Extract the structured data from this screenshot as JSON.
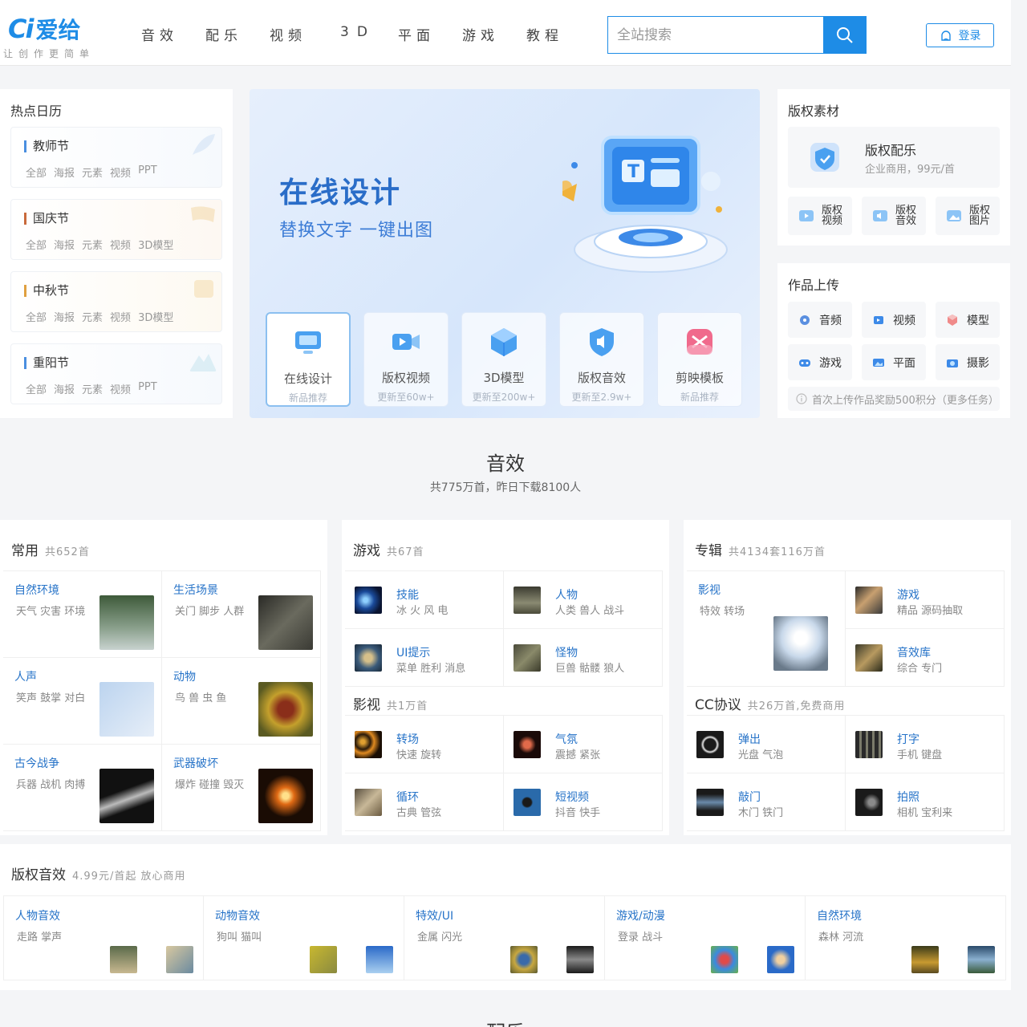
{
  "header": {
    "logo_ci": "Ci",
    "logo_name": "爱给",
    "slogan": "让创作更简单",
    "nav": [
      "音效",
      "配乐",
      "视频",
      "3D",
      "平面",
      "游戏",
      "教程"
    ],
    "search_placeholder": "全站搜索",
    "login": "登录"
  },
  "hot": {
    "title": "热点日历",
    "items": [
      {
        "name": "教师节",
        "tags": [
          "全部",
          "海报",
          "元素",
          "视频",
          "PPT"
        ],
        "color": "#4a8fe0"
      },
      {
        "name": "国庆节",
        "tags": [
          "全部",
          "海报",
          "元素",
          "视频",
          "3D模型"
        ],
        "color": "#c96a3c"
      },
      {
        "name": "中秋节",
        "tags": [
          "全部",
          "海报",
          "元素",
          "视频",
          "3D模型"
        ],
        "color": "#e0a040"
      },
      {
        "name": "重阳节",
        "tags": [
          "全部",
          "海报",
          "元素",
          "视频",
          "PPT"
        ],
        "color": "#4a8fe0"
      }
    ]
  },
  "banner": {
    "title": "在线设计",
    "subtitle": "替换文字  一键出图",
    "features": [
      {
        "label": "在线设计",
        "sub": "新品推荐"
      },
      {
        "label": "版权视频",
        "sub": "更新至60w+"
      },
      {
        "label": "3D模型",
        "sub": "更新至200w+"
      },
      {
        "label": "版权音效",
        "sub": "更新至2.9w+"
      },
      {
        "label": "剪映模板",
        "sub": "新品推荐"
      }
    ]
  },
  "copyright": {
    "title": "版权素材",
    "main_name": "版权配乐",
    "main_desc": "企业商用，99元/首",
    "subs": [
      {
        "label": "版权视频"
      },
      {
        "label": "版权音效"
      },
      {
        "label": "版权图片"
      }
    ]
  },
  "upload": {
    "title": "作品上传",
    "items": [
      "音频",
      "视频",
      "模型",
      "游戏",
      "平面",
      "摄影"
    ],
    "tip": "首次上传作品奖励500积分（更多任务）"
  },
  "section": {
    "title": "音效",
    "subtitle": "共775万首，昨日下载8100人"
  },
  "common": {
    "title": "常用",
    "count": "共652首",
    "cells": [
      {
        "name": "自然环境",
        "tags": "天气 灾害 环境"
      },
      {
        "name": "生活场景",
        "tags": "关门 脚步 人群"
      },
      {
        "name": "人声",
        "tags": "笑声 鼓掌 对白"
      },
      {
        "name": "动物",
        "tags": "鸟 兽 虫 鱼"
      },
      {
        "name": "古今战争",
        "tags": "兵器 战机 肉搏"
      },
      {
        "name": "武器破坏",
        "tags": "爆炸 碰撞 毁灭"
      }
    ]
  },
  "game": {
    "title": "游戏",
    "count": "共67首",
    "cells": [
      {
        "name": "技能",
        "tags": "冰 火 风 电"
      },
      {
        "name": "人物",
        "tags": "人类 兽人 战斗"
      },
      {
        "name": "UI提示",
        "tags": "菜单 胜利 消息"
      },
      {
        "name": "怪物",
        "tags": "巨兽 骷髅 狼人"
      }
    ]
  },
  "film": {
    "title": "影视",
    "count": "共1万首",
    "cells": [
      {
        "name": "转场",
        "tags": "快速 旋转"
      },
      {
        "name": "气氛",
        "tags": "震撼 紧张"
      },
      {
        "name": "循环",
        "tags": "古典 管弦"
      },
      {
        "name": "短视频",
        "tags": "抖音 快手"
      }
    ]
  },
  "album": {
    "title": "专辑",
    "count": "共4134套116万首",
    "big": {
      "name": "影视",
      "tags": "特效 转场"
    },
    "cells": [
      {
        "name": "游戏",
        "tags": "精品 源码抽取"
      },
      {
        "name": "音效库",
        "tags": "综合 专门"
      }
    ]
  },
  "cc": {
    "title": "CC协议",
    "count": "共26万首,免费商用",
    "cells": [
      {
        "name": "弹出",
        "tags": "光盘 气泡"
      },
      {
        "name": "打字",
        "tags": "手机 键盘"
      },
      {
        "name": "敲门",
        "tags": "木门 铁门"
      },
      {
        "name": "拍照",
        "tags": "相机 宝利来"
      }
    ]
  },
  "paid": {
    "title": "版权音效",
    "count": "4.99元/首起 放心商用",
    "cells": [
      {
        "name": "人物音效",
        "tags": "走路 掌声"
      },
      {
        "name": "动物音效",
        "tags": "狗叫 猫叫"
      },
      {
        "name": "特效/UI",
        "tags": "金属 闪光"
      },
      {
        "name": "游戏/动漫",
        "tags": "登录 战斗"
      },
      {
        "name": "自然环境",
        "tags": "森林 河流"
      }
    ]
  },
  "next_section": {
    "title": "配乐"
  },
  "colors": {
    "brand": "#1e8ce6",
    "link": "#2673c8"
  }
}
